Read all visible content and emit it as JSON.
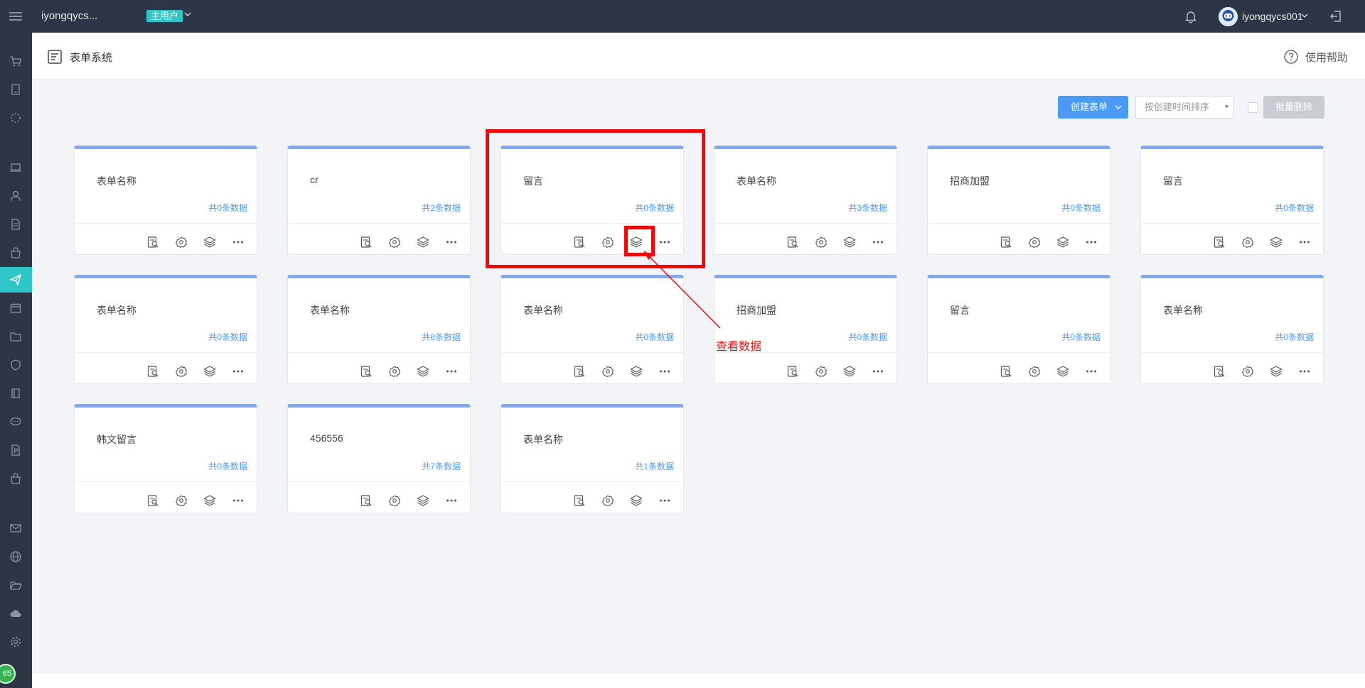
{
  "topbar": {
    "app_name": "iyongqycs...",
    "role_badge": "主用户",
    "username": "iyongqycs001"
  },
  "sidebar": {
    "items": [
      {
        "icon": "cart-icon"
      },
      {
        "icon": "device-icon"
      },
      {
        "icon": "loading-icon"
      },
      {
        "icon": "laptop-icon"
      },
      {
        "icon": "user-icon"
      },
      {
        "icon": "document-icon"
      },
      {
        "icon": "bag-icon"
      },
      {
        "icon": "send-icon",
        "active": true
      },
      {
        "icon": "calendar-icon"
      },
      {
        "icon": "folder-icon"
      },
      {
        "icon": "shield-icon"
      },
      {
        "icon": "book-icon"
      },
      {
        "icon": "chat-icon"
      },
      {
        "icon": "file-p-icon"
      },
      {
        "icon": "shop-icon"
      },
      {
        "icon": "mail-icon"
      },
      {
        "icon": "globe-icon"
      },
      {
        "icon": "open-folder-icon"
      },
      {
        "icon": "cloud-icon"
      },
      {
        "icon": "gear-icon"
      }
    ],
    "badge": "65"
  },
  "header": {
    "title": "表单系统",
    "help": "使用帮助"
  },
  "toolbar": {
    "create_label": "创建表单",
    "sort_placeholder": "按创建时间排序",
    "delete_label": "批量删除"
  },
  "cards": [
    {
      "name": "表单名称",
      "count": "共0条数据"
    },
    {
      "name": "cr",
      "count": "共2条数据"
    },
    {
      "name": "留言",
      "count": "共0条数据"
    },
    {
      "name": "表单名称",
      "count": "共3条数据"
    },
    {
      "name": "招商加盟",
      "count": "共0条数据"
    },
    {
      "name": "留言",
      "count": "共0条数据"
    },
    {
      "name": "表单名称",
      "count": "共0条数据"
    },
    {
      "name": "表单名称",
      "count": "共8条数据"
    },
    {
      "name": "表单名称",
      "count": "共0条数据"
    },
    {
      "name": "招商加盟",
      "count": "共0条数据"
    },
    {
      "name": "留言",
      "count": "共0条数据"
    },
    {
      "name": "表单名称",
      "count": "共0条数据"
    },
    {
      "name": "韩文留言",
      "count": "共0条数据"
    },
    {
      "name": "456556",
      "count": "共7条数据"
    },
    {
      "name": "表单名称",
      "count": "共1条数据"
    }
  ],
  "annotation": {
    "label": "查看数据",
    "color": "#ee0a0a"
  },
  "colors": {
    "topbar": "#2d3644",
    "accent": "#2ec7c9",
    "primary": "#4a9af7",
    "card_top": "#7fa9f5"
  }
}
